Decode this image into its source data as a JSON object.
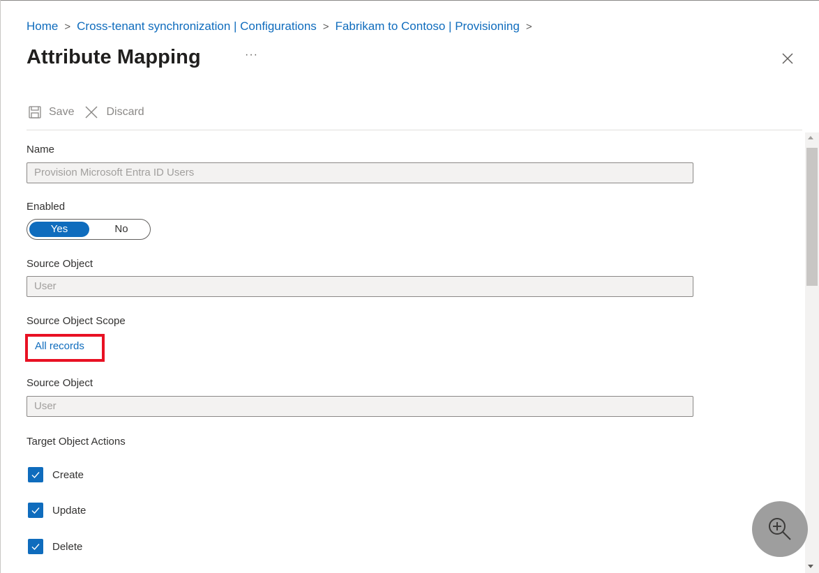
{
  "breadcrumb": {
    "items": [
      "Home",
      "Cross-tenant synchronization | Configurations",
      "Fabrikam to Contoso | Provisioning"
    ],
    "separator": ">"
  },
  "page": {
    "title": "Attribute Mapping",
    "more_label": "···"
  },
  "toolbar": {
    "save_label": "Save",
    "discard_label": "Discard"
  },
  "form": {
    "name_label": "Name",
    "name_value": "Provision Microsoft Entra ID Users",
    "enabled_label": "Enabled",
    "enabled_yes": "Yes",
    "enabled_no": "No",
    "enabled_selected": "Yes",
    "source_object_label": "Source Object",
    "source_object_value": "User",
    "source_scope_label": "Source Object Scope",
    "source_scope_link": "All records",
    "source_object2_label": "Source Object",
    "source_object2_value": "User",
    "target_actions_label": "Target Object Actions",
    "actions": [
      {
        "label": "Create",
        "checked": true
      },
      {
        "label": "Update",
        "checked": true
      },
      {
        "label": "Delete",
        "checked": true
      }
    ]
  },
  "icons": {
    "save": "save-icon",
    "discard": "discard-icon",
    "close": "close-icon",
    "zoom": "zoom-in-icon",
    "checkbox": "checkmark-icon"
  },
  "colors": {
    "accent": "#0f6cbd",
    "highlight": "#e81123",
    "disabled_field_bg": "#f3f2f1"
  }
}
